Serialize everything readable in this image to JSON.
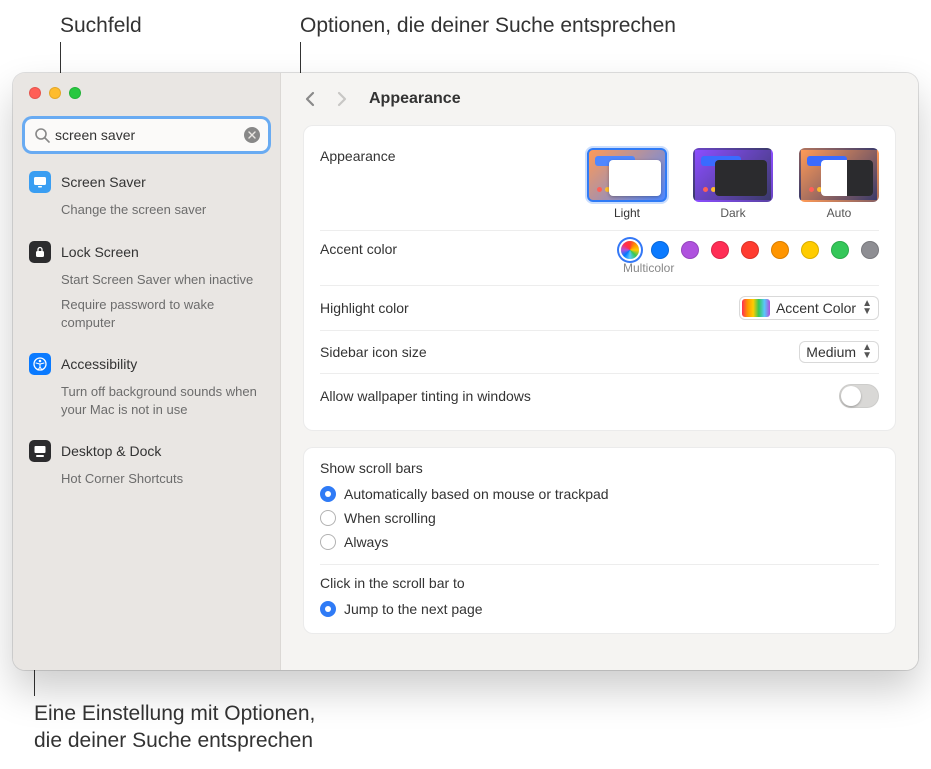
{
  "callouts": {
    "searchfield": "Suchfeld",
    "matching_options": "Optionen, die deiner Suche entsprechen",
    "setting_with_options_line1": "Eine Einstellung mit Optionen,",
    "setting_with_options_line2": "die deiner Suche entsprechen"
  },
  "toolbar": {
    "title": "Appearance"
  },
  "search": {
    "value": "screen saver"
  },
  "results": [
    {
      "icon": "screensaver",
      "title": "Screen Saver",
      "subs": [
        "Change the screen saver"
      ]
    },
    {
      "icon": "lock",
      "title": "Lock Screen",
      "subs": [
        "Start Screen Saver when inactive",
        "Require password to wake computer"
      ]
    },
    {
      "icon": "accessibility",
      "title": "Accessibility",
      "subs": [
        "Turn off background sounds when your Mac is not in use"
      ]
    },
    {
      "icon": "desktop",
      "title": "Desktop & Dock",
      "subs": [
        "Hot Corner Shortcuts"
      ]
    }
  ],
  "appearance": {
    "label": "Appearance",
    "options": [
      {
        "key": "light",
        "label": "Light",
        "selected": true
      },
      {
        "key": "dark",
        "label": "Dark",
        "selected": false
      },
      {
        "key": "auto",
        "label": "Auto",
        "selected": false
      }
    ]
  },
  "accent": {
    "label": "Accent color",
    "selected_label": "Multicolor",
    "colors": [
      {
        "key": "multicolor",
        "hex": "multicolor",
        "selected": true
      },
      {
        "key": "blue",
        "hex": "#0a7aff"
      },
      {
        "key": "purple",
        "hex": "#af52de"
      },
      {
        "key": "pink",
        "hex": "#ff2d55"
      },
      {
        "key": "red",
        "hex": "#ff3b30"
      },
      {
        "key": "orange",
        "hex": "#ff9500"
      },
      {
        "key": "yellow",
        "hex": "#ffcc00"
      },
      {
        "key": "green",
        "hex": "#34c759"
      },
      {
        "key": "graphite",
        "hex": "#8e8e93"
      }
    ]
  },
  "highlight": {
    "label": "Highlight color",
    "value": "Accent Color"
  },
  "sidebar_icon": {
    "label": "Sidebar icon size",
    "value": "Medium"
  },
  "wallpaper_tint": {
    "label": "Allow wallpaper tinting in windows",
    "enabled": false
  },
  "scrollbars": {
    "title": "Show scroll bars",
    "options": [
      {
        "label": "Automatically based on mouse or trackpad",
        "checked": true
      },
      {
        "label": "When scrolling",
        "checked": false
      },
      {
        "label": "Always",
        "checked": false
      }
    ]
  },
  "scrollclick": {
    "title": "Click in the scroll bar to",
    "options": [
      {
        "label": "Jump to the next page",
        "checked": true
      }
    ]
  }
}
